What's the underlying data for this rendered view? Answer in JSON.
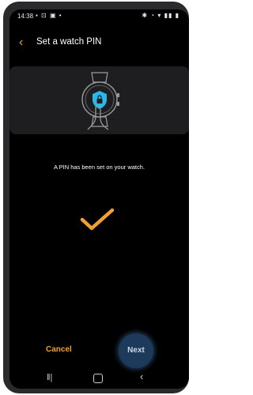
{
  "statusbar": {
    "time": "14:38",
    "left_icons": "▪ ⊡ ▣ •",
    "right_icons": "✱ ◔ ▾ ▮▮ ▮"
  },
  "appbar": {
    "back_icon": "chevron-left-icon",
    "title": "Set a watch PIN"
  },
  "hero": {
    "illustration": "watch-lock-icon",
    "accent_color": "#29b6e8"
  },
  "message": "A PIN has been set on your watch.",
  "check_icon": {
    "name": "checkmark-icon",
    "color": "#f0a030"
  },
  "actions": {
    "cancel_label": "Cancel",
    "next_label": "Next"
  },
  "navbar": {
    "recent_icon": "recent-apps-icon",
    "home_icon": "home-icon",
    "back_icon": "back-icon"
  }
}
